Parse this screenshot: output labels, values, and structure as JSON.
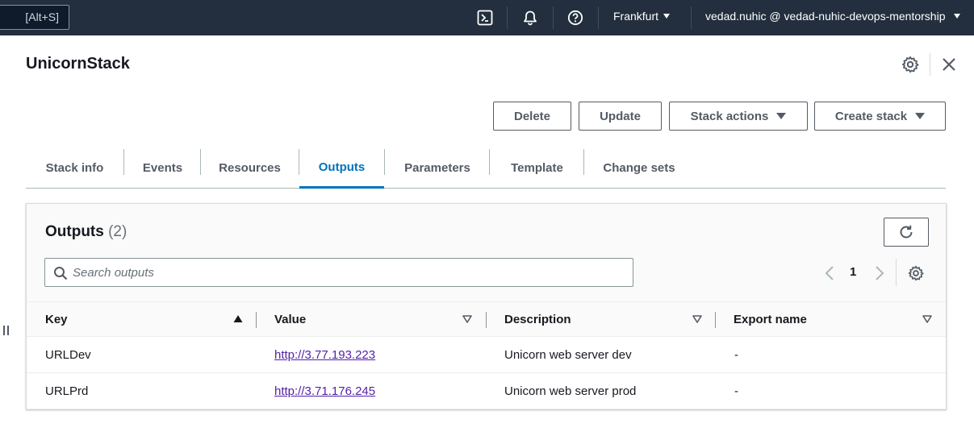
{
  "topnav": {
    "search_shortcut": "[Alt+S]",
    "region": "Frankfurt",
    "account": "vedad.nuhic @ vedad-nuhic-devops-mentorship",
    "icons": [
      "cloudshell-icon",
      "bell-icon",
      "help-icon"
    ]
  },
  "header": {
    "title": "UnicornStack"
  },
  "actions": {
    "delete": "Delete",
    "update": "Update",
    "stack_actions": "Stack actions",
    "create_stack": "Create stack"
  },
  "tabs": [
    {
      "label": "Stack info"
    },
    {
      "label": "Events"
    },
    {
      "label": "Resources"
    },
    {
      "label": "Outputs",
      "active": true
    },
    {
      "label": "Parameters"
    },
    {
      "label": "Template"
    },
    {
      "label": "Change sets"
    }
  ],
  "outputs": {
    "title": "Outputs",
    "count": "(2)",
    "search_placeholder": "Search outputs",
    "page": "1",
    "columns": [
      "Key",
      "Value",
      "Description",
      "Export name"
    ],
    "rows": [
      {
        "key": "URLDev",
        "value": "http://3.77.193.223",
        "description": "Unicorn web server dev",
        "export": "-"
      },
      {
        "key": "URLPrd",
        "value": "http://3.71.176.245",
        "description": "Unicorn web server prod",
        "export": "-"
      }
    ]
  },
  "colors": {
    "nav_bg": "#232f3e",
    "active_tab": "#0073bb",
    "link_visited": "#5521a8",
    "button_border": "#545b64"
  }
}
